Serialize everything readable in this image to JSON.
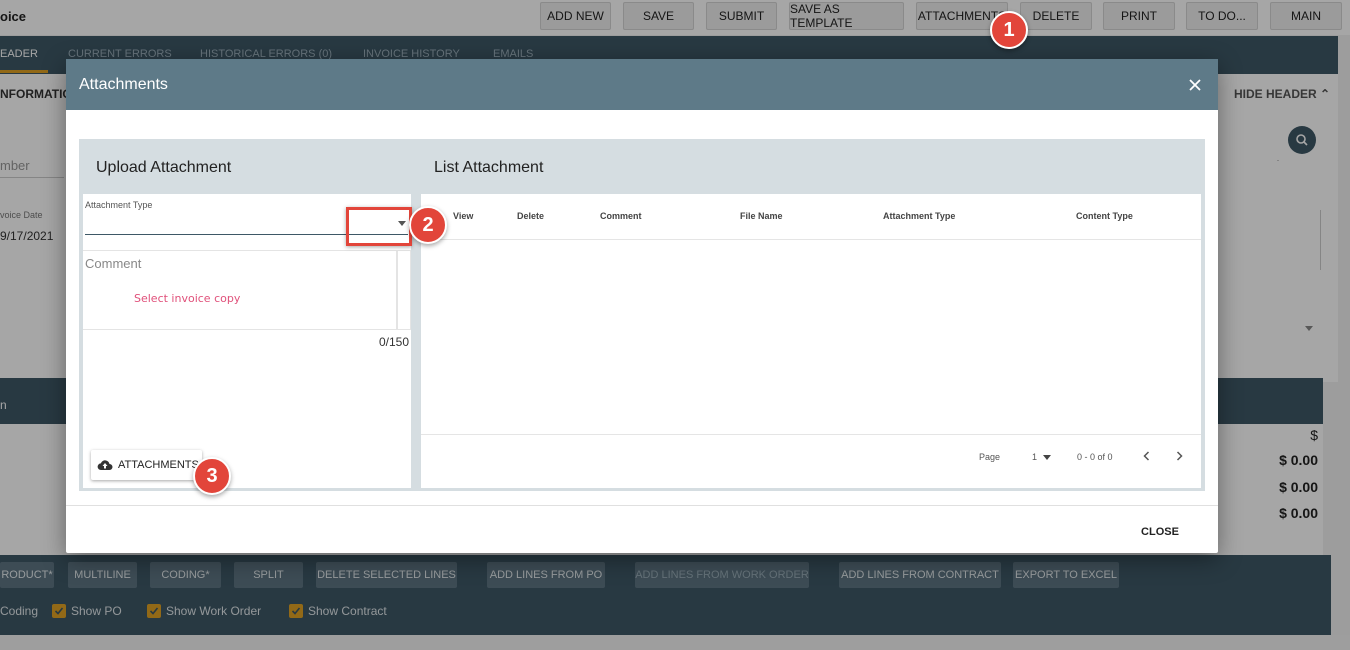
{
  "page": {
    "title": "oice",
    "top_buttons": [
      "ADD NEW",
      "SAVE",
      "SUBMIT",
      "SAVE AS TEMPLATE",
      "ATTACHMENTS",
      "DELETE",
      "PRINT",
      "TO DO...",
      "MAIN"
    ],
    "tabs": [
      "EADER",
      "CURRENT ERRORS",
      "HISTORICAL ERRORS (0)",
      "INVOICE HISTORY",
      "EMAILS"
    ],
    "info_label": "NFORMATIO",
    "hide_header": "HIDE HEADER",
    "fields": {
      "number_label": "mber",
      "invoice_date_label": "voice Date",
      "invoice_date_value": "9/17/2021"
    },
    "lines_header_text": "n",
    "totals": [
      "$",
      "$ 0.00",
      "$ 0.00",
      "$ 0.00"
    ],
    "bottom_buttons": [
      "RODUCT*",
      "MULTILINE",
      "CODING*",
      "SPLIT",
      "DELETE SELECTED LINES",
      "ADD LINES FROM PO",
      "ADD LINES FROM WORK ORDER",
      "ADD LINES FROM CONTRACT",
      "EXPORT TO EXCEL"
    ],
    "checkboxes": [
      "Coding",
      "Show PO",
      "Show Work Order",
      "Show Contract"
    ]
  },
  "modal": {
    "title": "Attachments",
    "upload": {
      "title": "Upload Attachment",
      "attachment_type_label": "Attachment Type",
      "comment_placeholder": "Comment",
      "comment_error": "Select invoice copy",
      "counter": "0/150",
      "attach_button": "ATTACHMENTS"
    },
    "list": {
      "title": "List Attachment",
      "columns": [
        "View",
        "Delete",
        "Comment",
        "File Name",
        "Attachment Type",
        "Content Type"
      ],
      "pagination": {
        "page_label": "Page",
        "page_value": "1",
        "range": "0 - 0 of 0"
      }
    },
    "close_button": "CLOSE"
  },
  "callouts": [
    "1",
    "2",
    "3"
  ],
  "colors": {
    "header_bg": "#3e5866",
    "modal_header": "#5e7a88",
    "accent": "#e0a224",
    "callout": "#e2453a",
    "error_text": "#e0507a"
  }
}
